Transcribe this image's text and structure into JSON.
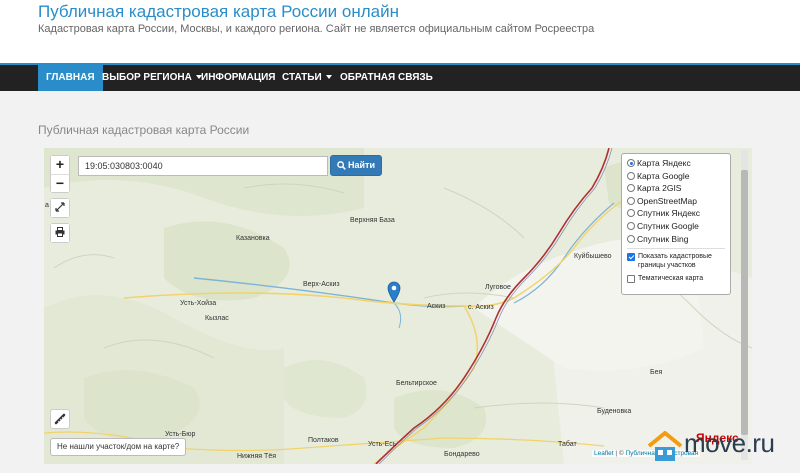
{
  "header": {
    "title": "Публичная кадастровая карта России онлайн",
    "subtitle": "Кадастровая карта России, Москвы, и каждого региона. Сайт не является официальным сайтом Росреестра"
  },
  "nav": {
    "items": [
      {
        "label": "ГЛАВНАЯ"
      },
      {
        "label": "ВЫБОР РЕГИОНА"
      },
      {
        "label": "ИНФОРМАЦИЯ"
      },
      {
        "label": "СТАТЬИ"
      },
      {
        "label": "ОБРАТНАЯ СВЯЗЬ"
      }
    ]
  },
  "section": {
    "title": "Публичная кадастровая карта России"
  },
  "map": {
    "zoom_in": "+",
    "zoom_out": "−",
    "search": {
      "value": "19:05:030803:0040",
      "button": "Найти"
    },
    "layers": [
      {
        "label": "Карта Яндекс",
        "selected": true
      },
      {
        "label": "Карта Google",
        "selected": false
      },
      {
        "label": "Карта 2GIS",
        "selected": false
      },
      {
        "label": "OpenStreetMap",
        "selected": false
      },
      {
        "label": "Спутник Яндекс",
        "selected": false
      },
      {
        "label": "Спутник Google",
        "selected": false
      },
      {
        "label": "Спутник Bing",
        "selected": false
      }
    ],
    "overlays": [
      {
        "label": "Показать кадастровые границы участков",
        "checked": true
      },
      {
        "label": "Тематическая карта",
        "checked": false
      }
    ],
    "not_found_button": "Не нашли участок/дом на карте?",
    "attribution": {
      "leaflet": "Leaflet",
      "sep": " | © ",
      "source": "Публичная кадастровая"
    },
    "yandex_logo": "Яндекс",
    "places": [
      {
        "name": "Верхняя База"
      },
      {
        "name": "Казановка"
      },
      {
        "name": "Верх-Аскиз"
      },
      {
        "name": "Аскиз"
      },
      {
        "name": "с. Аскиз"
      },
      {
        "name": "Луговое"
      },
      {
        "name": "Усть-Хойза"
      },
      {
        "name": "Кызлас"
      },
      {
        "name": "Куйбышево"
      },
      {
        "name": "Бельтирское"
      },
      {
        "name": "Бея"
      },
      {
        "name": "Буденовка"
      },
      {
        "name": "Полтаков"
      },
      {
        "name": "Усть-Есь"
      },
      {
        "name": "Табат"
      },
      {
        "name": "Бондарево"
      },
      {
        "name": "Нижняя Тёя"
      },
      {
        "name": "Усть-Бюр"
      },
      {
        "name": "а"
      }
    ]
  },
  "watermark": {
    "text": "move.ru"
  },
  "colors": {
    "accent": "#2a8dc9",
    "navbar": "#222222",
    "button": "#337ab7",
    "border_red": "#b03030"
  }
}
